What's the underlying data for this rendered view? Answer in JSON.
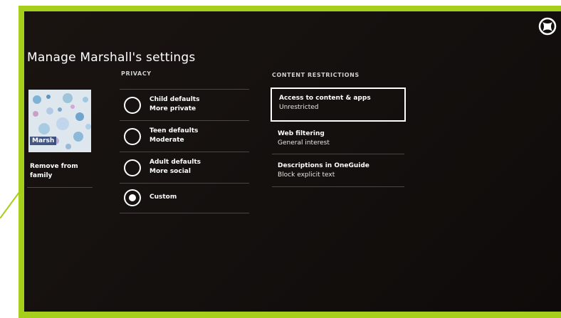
{
  "page": {
    "title": "Manage Marshall's settings"
  },
  "profile": {
    "gamertag": "Marsh",
    "remove_label": "Remove from family"
  },
  "privacy": {
    "heading": "PRIVACY",
    "options": [
      {
        "title": "Child defaults",
        "subtitle": "More private",
        "selected": false
      },
      {
        "title": "Teen defaults",
        "subtitle": "Moderate",
        "selected": false
      },
      {
        "title": "Adult defaults",
        "subtitle": "More social",
        "selected": false
      },
      {
        "title": "Custom",
        "subtitle": "",
        "selected": true
      }
    ]
  },
  "content_restrictions": {
    "heading": "CONTENT RESTRICTIONS",
    "items": [
      {
        "title": "Access to content & apps",
        "value": "Unrestricted",
        "focused": true
      },
      {
        "title": "Web filtering",
        "value": "General interest",
        "focused": false
      },
      {
        "title": "Descriptions in OneGuide",
        "value": "Block explicit text",
        "focused": false
      }
    ]
  },
  "colors": {
    "frame_accent": "#a6cf1c",
    "background": "#15110f",
    "text": "#ffffff"
  },
  "icons": {
    "logo": "xbox-logo-icon",
    "radio": "radio-button-icon"
  }
}
